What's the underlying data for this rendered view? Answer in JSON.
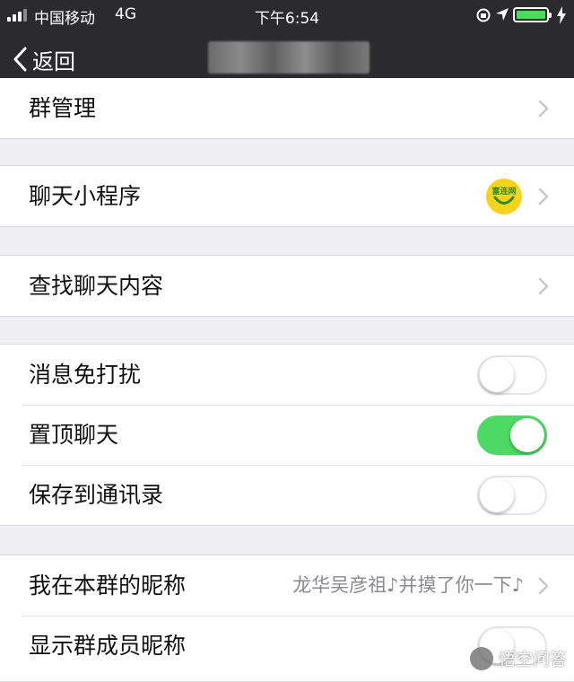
{
  "status_bar": {
    "carrier": "中国移动",
    "network": "4G",
    "time": "下午6:54"
  },
  "nav": {
    "back_label": "返回"
  },
  "groups": {
    "group_manage": {
      "label": "群管理"
    },
    "mini_program": {
      "label": "聊天小程序",
      "icon": "富连网"
    },
    "search_chat": {
      "label": "查找聊天内容"
    },
    "dnd": {
      "label": "消息免打扰",
      "on": false
    },
    "pin": {
      "label": "置顶聊天",
      "on": true
    },
    "save_contacts": {
      "label": "保存到通讯录",
      "on": false
    },
    "my_nickname": {
      "label": "我在本群的昵称",
      "value": "龙华吴彦祖♪并摸了你一下♪"
    },
    "show_nicknames": {
      "label": "显示群成员昵称",
      "on": false
    }
  },
  "watermark": {
    "text": "悟空问答"
  },
  "colors": {
    "toggle_on": "#4cd964",
    "topbar": "#2b2b2e",
    "battery": "#4cd964"
  }
}
